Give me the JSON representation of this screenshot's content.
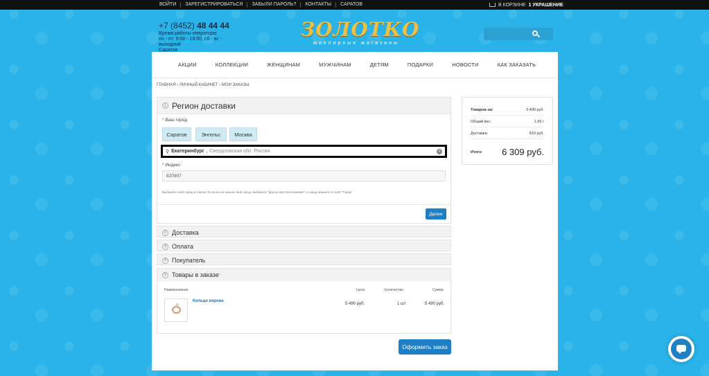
{
  "topbar": {
    "links": [
      "ВОЙТИ",
      "ЗАРЕГИСТРИРОВАТЬСЯ",
      "ЗАБЫЛИ ПАРОЛЬ?",
      "КОНТАКТЫ",
      "САРАТОВ"
    ],
    "cart_prefix": "В КОРЗИНЕ",
    "cart_count": "1 УКРАШЕНИЕ"
  },
  "header": {
    "phone_code": "+7 (8452)",
    "phone_number": "48 44 44",
    "hours_title": "Время работы оператора:",
    "hours_value": "пн - пт: 9:00 - 19:00, сб - вс - выходной",
    "city": "Саратов",
    "logo_name": "ЗОЛОТКО",
    "logo_sub": "ювелирные магазины"
  },
  "nav": [
    "АКЦИИ",
    "КОЛЛЕКЦИИ",
    "ЖЕНЩИНАМ",
    "МУЖЧИНАМ",
    "ДЕТЯМ",
    "ПОДАРКИ",
    "НОВОСТИ",
    "КАК ЗАКАЗАТЬ"
  ],
  "breadcrumb": "ГЛАВНАЯ › ЛИЧНЫЙ КАБИНЕТ › МОИ ЗАКАЗЫ",
  "region": {
    "num": "1",
    "title": "Регион доставки",
    "city_label": "Ваш город",
    "cities": [
      "Саратов",
      "Энгельс",
      "Москва"
    ],
    "city_query": "Екатеринбург",
    "city_hint": "Свердловская обл, Россия",
    "index_label": "Индекс",
    "index_value": "620907",
    "help": "Выберите свой город в списке. Если вы не нашли свой город, выберите \"другое местоположение\", а город впишите в поле \"Город\"",
    "next_label": "Далее"
  },
  "sections": [
    {
      "num": "2",
      "title": "Доставка"
    },
    {
      "num": "3",
      "title": "Оплата"
    },
    {
      "num": "4",
      "title": "Покупатель"
    }
  ],
  "goods": {
    "num": "5",
    "title": "Товары в заказе",
    "headers": {
      "name": "Наименование",
      "price": "Цена",
      "qty": "Количество",
      "sum": "Сумма"
    },
    "item": {
      "name": "Кольцо корона",
      "price": "5 490 руб.",
      "qty": "1 шт",
      "sum": "5 490 руб."
    }
  },
  "order_button": "Оформить заказ",
  "summary": {
    "goods_label": "Товаров на:",
    "goods_value": "5 490 руб.",
    "weight_label": "Общий вес:",
    "weight_value": "1.65 г",
    "delivery_label": "Доставка:",
    "delivery_value": "819 руб.",
    "total_label": "Итого:",
    "total_value": "6 309 руб."
  }
}
